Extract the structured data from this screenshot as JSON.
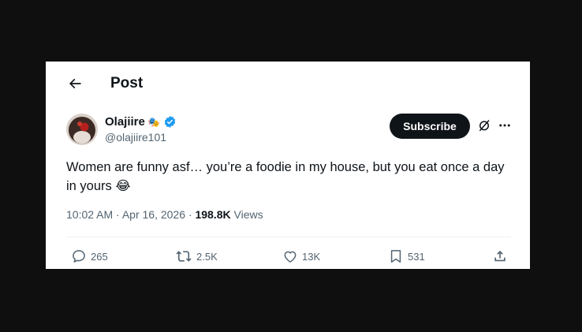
{
  "header": {
    "title": "Post"
  },
  "author": {
    "name": "Olajiire",
    "badge_emoji": "🎭",
    "handle": "@olajiire101"
  },
  "subscribe_label": "Subscribe",
  "tweet": {
    "text": "Women are funny asf… you’re a foodie in my house, but you eat once a day in yours 😂"
  },
  "meta": {
    "time": "10:02 AM",
    "sep1": " · ",
    "date": "Apr 16, 2026",
    "sep2": " · ",
    "views_count": "198.8K",
    "views_label": " Views"
  },
  "actions": {
    "replies": "265",
    "reposts": "2.5K",
    "likes": "13K",
    "bookmarks": "531"
  },
  "colors": {
    "background": "#0f0f0f",
    "card": "#ffffff",
    "text": "#0f1419",
    "muted": "#536471",
    "verified": "#1d9bf0"
  }
}
